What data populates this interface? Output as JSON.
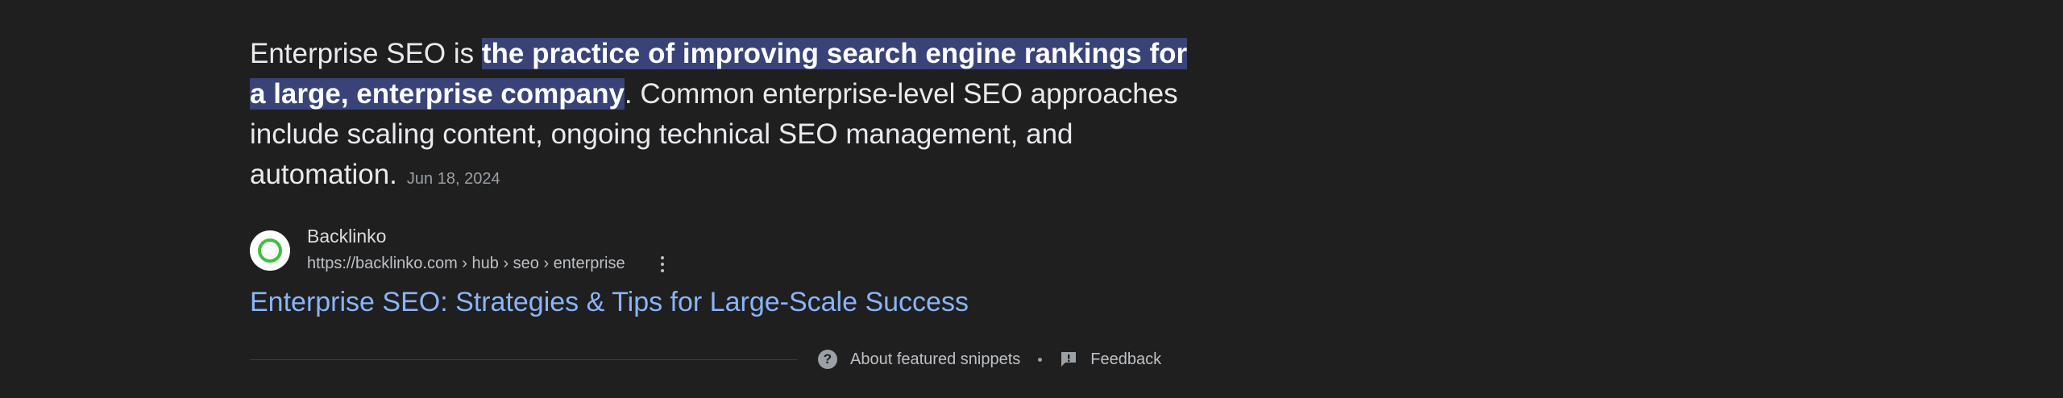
{
  "snippet": {
    "lead": "Enterprise SEO is ",
    "highlight": "the practice of improving search engine rankings for a large, enterprise company",
    "rest": ". Common enterprise-level SEO approaches include scaling content, ongoing technical SEO management, and automation.",
    "date": "Jun 18, 2024"
  },
  "source": {
    "favicon": "backlinko-logo-icon",
    "name": "Backlinko",
    "url": "https://backlinko.com › hub › seo › enterprise",
    "menu_icon": "more-vert-icon"
  },
  "result": {
    "title": "Enterprise SEO: Strategies & Tips for Large-Scale Success"
  },
  "footer": {
    "about_icon": "help-icon",
    "about_label": "About featured snippets",
    "separator": "•",
    "feedback_icon": "feedback-icon",
    "feedback_label": "Feedback"
  },
  "colors": {
    "background": "#1f1f1f",
    "highlight": "#394377",
    "link": "#8ab4f8"
  }
}
